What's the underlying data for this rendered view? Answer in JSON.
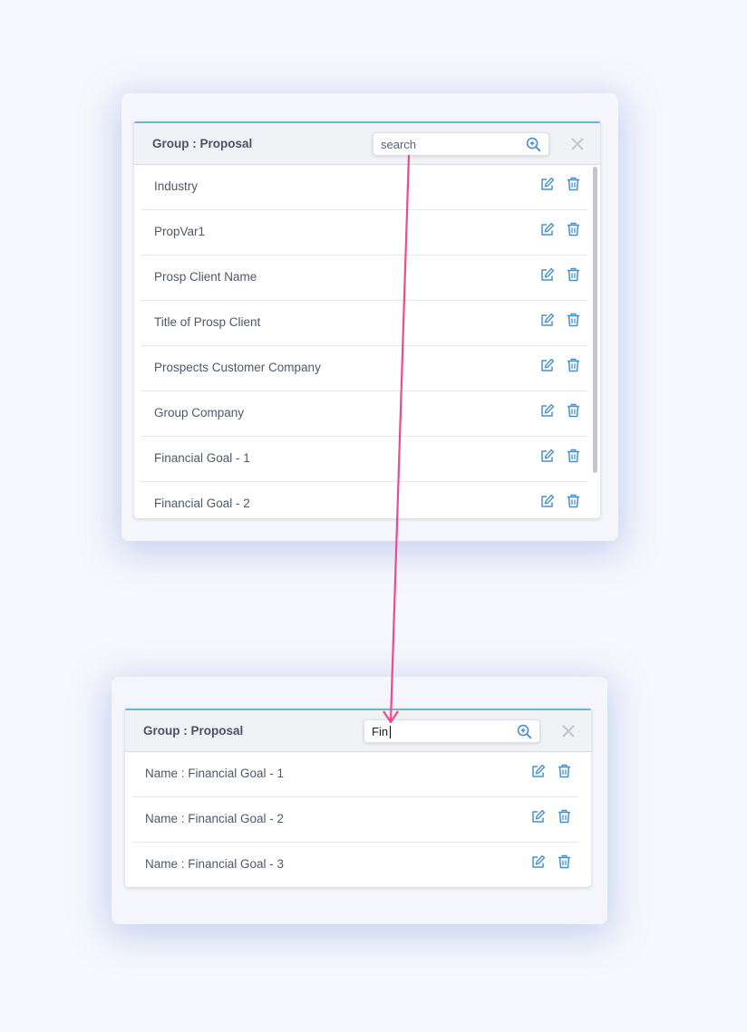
{
  "panel_top": {
    "title": "Group : Proposal",
    "search": {
      "value": "",
      "placeholder": "search"
    },
    "items": [
      {
        "label": "Industry"
      },
      {
        "label": "PropVar1"
      },
      {
        "label": "Prosp Client Name"
      },
      {
        "label": "Title of Prosp Client"
      },
      {
        "label": "Prospects Customer Company"
      },
      {
        "label": "Group Company"
      },
      {
        "label": "Financial Goal - 1"
      },
      {
        "label": "Financial Goal - 2"
      }
    ]
  },
  "panel_bottom": {
    "title": "Group : Proposal",
    "search": {
      "value": "Fin",
      "placeholder": "search"
    },
    "items": [
      {
        "label": "Name : Financial Goal - 1"
      },
      {
        "label": "Name : Financial Goal - 2"
      },
      {
        "label": "Name : Financial Goal - 3"
      }
    ]
  },
  "icons": {
    "search": "search-zoom-icon",
    "close": "close-icon",
    "edit": "edit-icon",
    "delete": "trash-icon"
  },
  "colors": {
    "accent": "#4a90c8",
    "header_border": "#6cb6da",
    "annotation_arrow": "#ee4a8e",
    "icon_muted": "#c2c6ce"
  }
}
